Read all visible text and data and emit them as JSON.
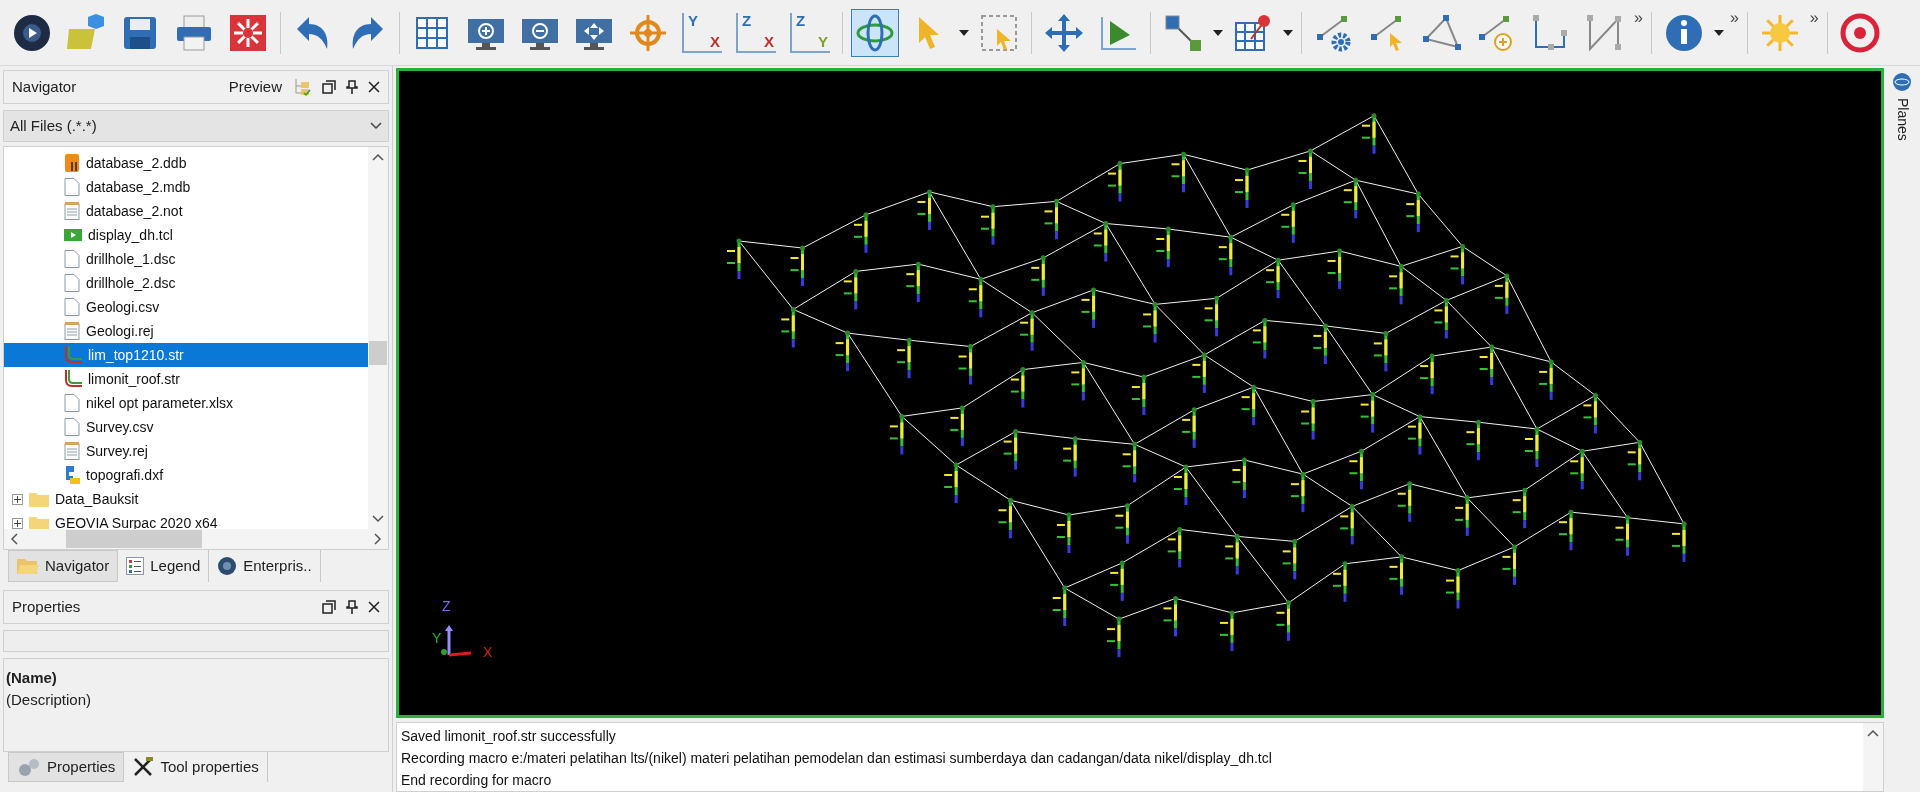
{
  "toolbar": [
    {
      "kind": "disc"
    },
    {
      "kind": "open"
    },
    {
      "kind": "save"
    },
    {
      "kind": "print"
    },
    {
      "kind": "burst"
    },
    {
      "kind": "sep"
    },
    {
      "kind": "undo"
    },
    {
      "kind": "redo"
    },
    {
      "kind": "sep"
    },
    {
      "kind": "grid"
    },
    {
      "kind": "zoom-in"
    },
    {
      "kind": "zoom-out"
    },
    {
      "kind": "zoom-fit"
    },
    {
      "kind": "crosshair"
    },
    {
      "kind": "axis",
      "labels": [
        "Y",
        "X"
      ]
    },
    {
      "kind": "axis",
      "labels": [
        "Z",
        "X"
      ]
    },
    {
      "kind": "axis",
      "labels": [
        "Z",
        "Y"
      ]
    },
    {
      "kind": "sep"
    },
    {
      "kind": "rotate",
      "selected": true
    },
    {
      "kind": "pointer"
    },
    {
      "kind": "caret"
    },
    {
      "kind": "select-box"
    },
    {
      "kind": "sep"
    },
    {
      "kind": "move"
    },
    {
      "kind": "triangle"
    },
    {
      "kind": "sep"
    },
    {
      "kind": "segment"
    },
    {
      "kind": "caret"
    },
    {
      "kind": "grid-pin"
    },
    {
      "kind": "caret"
    },
    {
      "kind": "sep"
    },
    {
      "kind": "line-gear"
    },
    {
      "kind": "line-pick"
    },
    {
      "kind": "polygon"
    },
    {
      "kind": "line-add"
    },
    {
      "kind": "steps"
    },
    {
      "kind": "zigzag"
    },
    {
      "kind": "more",
      "text": "»"
    },
    {
      "kind": "sep"
    },
    {
      "kind": "info"
    },
    {
      "kind": "caret"
    },
    {
      "kind": "more",
      "text": "»"
    },
    {
      "kind": "sep"
    },
    {
      "kind": "sun"
    },
    {
      "kind": "more",
      "text": "»"
    },
    {
      "kind": "sep"
    },
    {
      "kind": "bullseye"
    }
  ],
  "navigator": {
    "title": "Navigator",
    "preview": "Preview",
    "filter": "All Files (.*.*)",
    "files": [
      {
        "label": "database_2.ddb",
        "kind": "db",
        "selected": false
      },
      {
        "label": "database_2.mdb",
        "kind": "blank",
        "selected": false
      },
      {
        "label": "database_2.not",
        "kind": "note",
        "selected": false
      },
      {
        "label": "display_dh.tcl",
        "kind": "script",
        "selected": false
      },
      {
        "label": "drillhole_1.dsc",
        "kind": "blank",
        "selected": false
      },
      {
        "label": "drillhole_2.dsc",
        "kind": "blank",
        "selected": false
      },
      {
        "label": "Geologi.csv",
        "kind": "blank",
        "selected": false
      },
      {
        "label": "Geologi.rej",
        "kind": "note",
        "selected": false
      },
      {
        "label": "lim_top1210.str",
        "kind": "string",
        "selected": true
      },
      {
        "label": "limonit_roof.str",
        "kind": "string",
        "selected": false
      },
      {
        "label": "nikel opt parameter.xlsx",
        "kind": "blank",
        "selected": false
      },
      {
        "label": "Survey.csv",
        "kind": "blank",
        "selected": false
      },
      {
        "label": "Survey.rej",
        "kind": "note",
        "selected": false
      },
      {
        "label": "topografi.dxf",
        "kind": "dxf",
        "selected": false
      }
    ],
    "folders": [
      {
        "label": "Data_Bauksit",
        "expanded": false
      },
      {
        "label": "GEOVIA Surpac 2020 x64",
        "expanded": false
      }
    ],
    "tabs": [
      {
        "label": "Navigator",
        "kind": "folder",
        "selected": true
      },
      {
        "label": "Legend",
        "kind": "list",
        "selected": false
      },
      {
        "label": "Enterpris..",
        "kind": "globe",
        "selected": false
      }
    ]
  },
  "properties": {
    "title": "Properties",
    "name": "(Name)",
    "description": "(Description)",
    "tabs": [
      {
        "label": "Properties",
        "kind": "gears",
        "selected": true
      },
      {
        "label": "Tool properties",
        "kind": "tools",
        "selected": false
      }
    ]
  },
  "viewport": {
    "axes": {
      "x": "X",
      "y": "Y",
      "z": "Z"
    }
  },
  "side_tab": "Planes",
  "log": [
    "Saved limonit_roof.str successfully",
    "Recording macro e:/materi pelatihan lts/(nikel) materi pelatihan pemodelan dan estimasi sumberdaya dan cadangan/data nikel/display_dh.tcl",
    "End recording for macro"
  ]
}
